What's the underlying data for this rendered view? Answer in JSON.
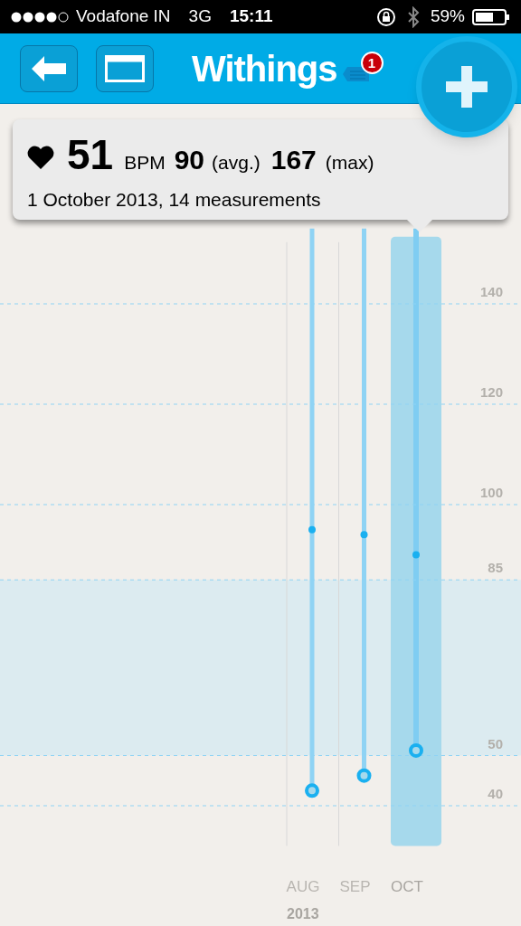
{
  "status_bar": {
    "carrier": "Vodafone IN",
    "network": "3G",
    "time": "15:11",
    "battery": "59%"
  },
  "header": {
    "title": "Withings",
    "badge": "1"
  },
  "tooltip": {
    "value": "51",
    "unit": "BPM",
    "avg": "90",
    "avg_label": "(avg.)",
    "max": "167",
    "max_label": "(max)",
    "subtitle": "1 October 2013, 14 measurements"
  },
  "chart": {
    "year": "2013",
    "columns": [
      {
        "selected": false
      },
      {
        "selected": false
      },
      {
        "selected": true
      }
    ],
    "chart_data": {
      "type": "scatter",
      "categories": [
        "AUG",
        "SEP",
        "OCT"
      ],
      "series": [
        {
          "color": "#1ab0f0",
          "values": [
            43,
            46,
            51
          ]
        },
        {
          "color": "#1ab0f0",
          "values": [
            95,
            94,
            90
          ]
        }
      ],
      "ylim": [
        40,
        140
      ],
      "yticks": [
        40,
        50,
        85,
        100,
        120,
        140
      ],
      "grid": true
    }
  }
}
